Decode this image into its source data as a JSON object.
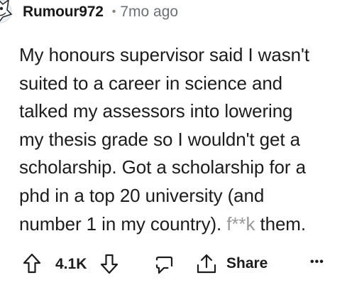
{
  "comment": {
    "username": "Rumour972",
    "separator": "•",
    "timestamp": "7mo ago",
    "body": "My honours supervisor said I wasn't suited to a career in science and talked my assessors into lowering my thesis grade so I wouldn't get a scholarship. Got a scholarship for a phd in a top 20 university (and number 1 in my country). f**k them.",
    "lines": [
      "My honours supervisor said I wasn't",
      "suited to a career in science and",
      "talked my assessors into lowering",
      "my thesis grade so I wouldn't get a",
      "scholarship. Got a scholarship for a",
      "phd in a top 20 university (and",
      "number 1 in my country). ",
      "them."
    ],
    "obscured_word": "f**k"
  },
  "actions": {
    "upvote_icon": "arrow-up-icon",
    "vote_count": "4.1K",
    "downvote_icon": "arrow-down-icon",
    "reply_icon": "comment-icon",
    "share_icon": "share-icon",
    "share_label": "Share",
    "more_icon": "more-horizontal-icon",
    "more_label": "•••"
  },
  "colors": {
    "text": "#1c1c1c",
    "meta": "#6b7176",
    "background": "#ffffff"
  }
}
